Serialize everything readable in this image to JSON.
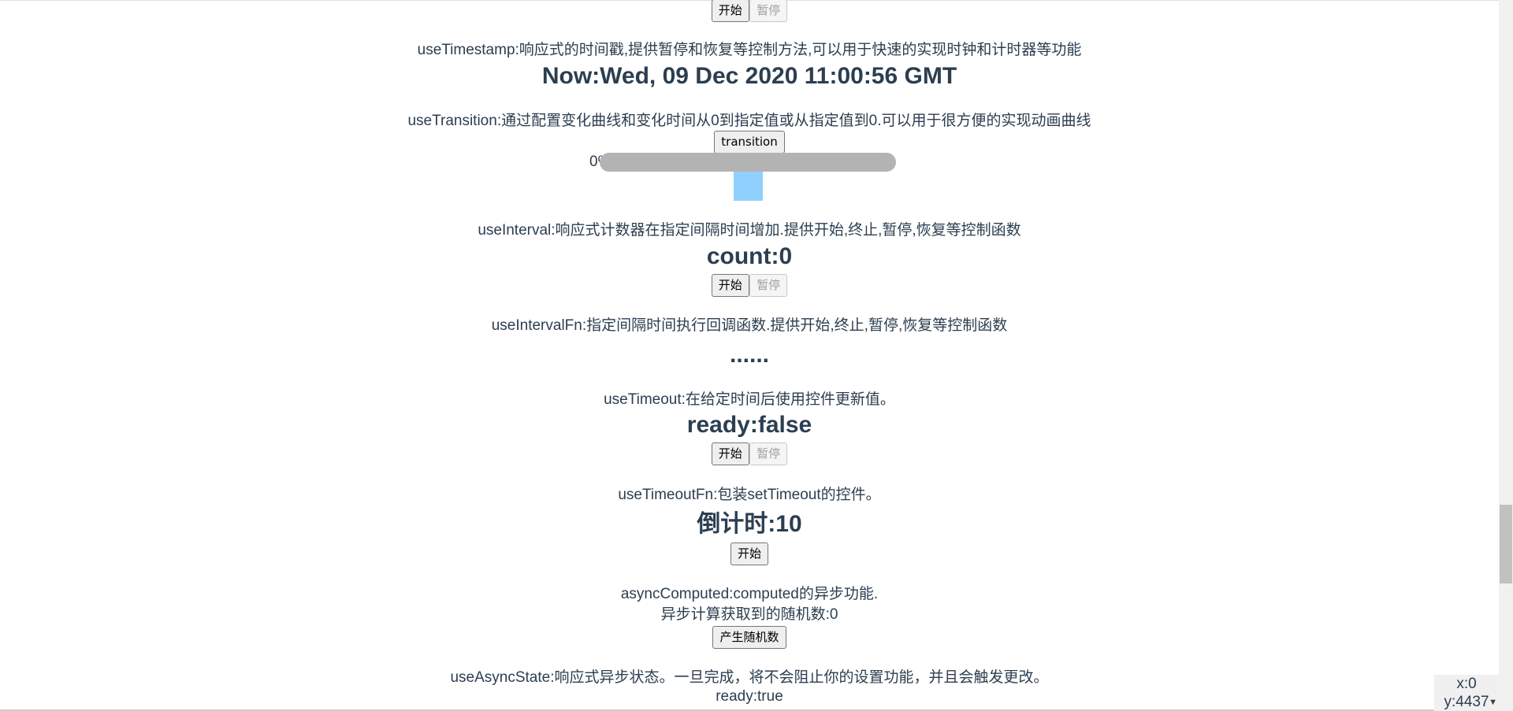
{
  "top_controls": {
    "start_label": "开始",
    "pause_label": "暂停"
  },
  "timestamp": {
    "desc": "useTimestamp:响应式的时间戳,提供暂停和恢复等控制方法,可以用于快速的实现时钟和计时器等功能",
    "value": "Now:Wed, 09 Dec 2020 11:00:56 GMT"
  },
  "transition": {
    "desc": "useTransition:通过配置变化曲线和变化时间从0到指定值或从指定值到0.可以用于很方便的实现动画曲线",
    "button_label": "transition",
    "progress_label": "0%",
    "progress": 0
  },
  "interval": {
    "desc": "useInterval:响应式计数器在指定间隔时间增加.提供开始,终止,暂停,恢复等控制函数",
    "value": "count:0",
    "start_label": "开始",
    "pause_label": "暂停"
  },
  "interval_fn": {
    "desc": "useIntervalFn:指定间隔时间执行回调函数.提供开始,终止,暂停,恢复等控制函数",
    "value": "......"
  },
  "timeout": {
    "desc": "useTimeout:在给定时间后使用控件更新值。",
    "value": "ready:false",
    "start_label": "开始",
    "pause_label": "暂停"
  },
  "timeout_fn": {
    "desc": "useTimeoutFn:包装setTimeout的控件。",
    "value": "倒计时:10",
    "start_label": "开始"
  },
  "async_computed": {
    "desc": "asyncComputed:computed的异步功能.",
    "result": "异步计算获取到的随机数:0",
    "button_label": "产生随机数"
  },
  "async_state": {
    "desc": "useAsyncState:响应式异步状态。一旦完成，将不会阻止你的设置功能，并且会触发更改。",
    "value": "ready:true"
  },
  "mouse_coords": {
    "x": "x:0",
    "y": "y:4437"
  }
}
